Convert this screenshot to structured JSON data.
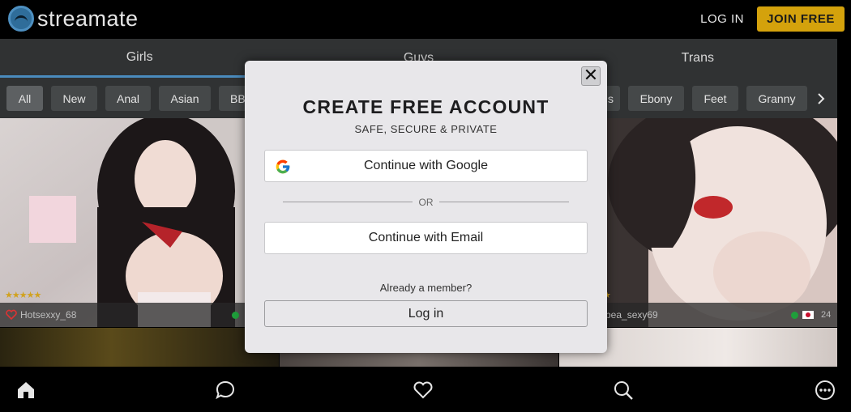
{
  "header": {
    "logo_text": "streamate",
    "login_label": "LOG IN",
    "join_label": "JOIN FREE"
  },
  "gender_tabs": [
    {
      "label": "Girls",
      "active": true
    },
    {
      "label": "Guys",
      "active": false
    },
    {
      "label": "Trans",
      "active": false
    }
  ],
  "categories": [
    {
      "label": "All",
      "active": true
    },
    {
      "label": "New"
    },
    {
      "label": "Anal"
    },
    {
      "label": "Asian"
    },
    {
      "label": "BB"
    },
    {
      "label": "s"
    },
    {
      "label": "Ebony"
    },
    {
      "label": "Feet"
    },
    {
      "label": "Granny"
    }
  ],
  "cards": [
    {
      "name": "Hotsexxy_68",
      "stars": "★★★★★"
    },
    {
      "name": "bea_sexy69",
      "stars": "★",
      "viewers": "24"
    }
  ],
  "modal": {
    "title": "CREATE FREE ACCOUNT",
    "subtitle": "SAFE, SECURE & PRIVATE",
    "google_label": "Continue with Google",
    "or_label": "OR",
    "email_label": "Continue with Email",
    "member_text": "Already a member?",
    "login_label": "Log in",
    "close_glyph": "✕"
  },
  "bottom_nav": [
    "home-icon",
    "chat-icon",
    "favorites-icon",
    "search-icon",
    "more-icon"
  ],
  "colors": {
    "accent": "#4a8bbd",
    "join_button": "#d4a20c",
    "online": "#1f9e3b"
  }
}
